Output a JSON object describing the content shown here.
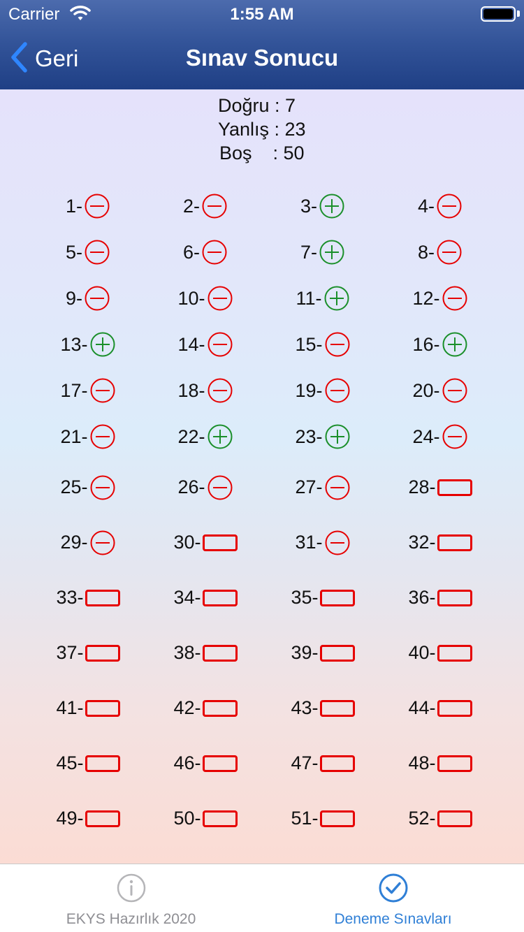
{
  "status_bar": {
    "carrier": "Carrier",
    "time": "1:55 AM",
    "icons": [
      "wifi-icon",
      "battery-icon"
    ]
  },
  "nav": {
    "back_label": "Geri",
    "title": "Sınav Sonucu"
  },
  "summary": {
    "dogru": "Doğru  :  7",
    "yanlis": "Yanlış : 23",
    "bos": "Boş    : 50"
  },
  "colors": {
    "correct": "#1a8f2a",
    "wrong": "#e60000",
    "blank": "#e60000",
    "tab_active": "#2f7fd6",
    "tab_inactive": "#8e8e93"
  },
  "questions": [
    {
      "label": "1-",
      "status": "wrong"
    },
    {
      "label": "2-",
      "status": "wrong"
    },
    {
      "label": "3-",
      "status": "correct"
    },
    {
      "label": "4-",
      "status": "wrong"
    },
    {
      "label": "5-",
      "status": "wrong"
    },
    {
      "label": "6-",
      "status": "wrong"
    },
    {
      "label": "7-",
      "status": "correct"
    },
    {
      "label": "8-",
      "status": "wrong"
    },
    {
      "label": "9-",
      "status": "wrong"
    },
    {
      "label": "10-",
      "status": "wrong"
    },
    {
      "label": "11-",
      "status": "correct"
    },
    {
      "label": "12-",
      "status": "wrong"
    },
    {
      "label": "13-",
      "status": "correct"
    },
    {
      "label": "14-",
      "status": "wrong"
    },
    {
      "label": "15-",
      "status": "wrong"
    },
    {
      "label": "16-",
      "status": "correct"
    },
    {
      "label": "17-",
      "status": "wrong"
    },
    {
      "label": "18-",
      "status": "wrong"
    },
    {
      "label": "19-",
      "status": "wrong"
    },
    {
      "label": "20-",
      "status": "wrong"
    },
    {
      "label": "21-",
      "status": "wrong"
    },
    {
      "label": "22-",
      "status": "correct"
    },
    {
      "label": "23-",
      "status": "correct"
    },
    {
      "label": "24-",
      "status": "wrong"
    },
    {
      "label": "25-",
      "status": "wrong"
    },
    {
      "label": "26-",
      "status": "wrong"
    },
    {
      "label": "27-",
      "status": "wrong"
    },
    {
      "label": "28-",
      "status": "blank"
    },
    {
      "label": "29-",
      "status": "wrong"
    },
    {
      "label": "30-",
      "status": "blank"
    },
    {
      "label": "31-",
      "status": "wrong"
    },
    {
      "label": "32-",
      "status": "blank"
    },
    {
      "label": "33-",
      "status": "blank"
    },
    {
      "label": "34-",
      "status": "blank"
    },
    {
      "label": "35-",
      "status": "blank"
    },
    {
      "label": "36-",
      "status": "blank"
    },
    {
      "label": "37-",
      "status": "blank"
    },
    {
      "label": "38-",
      "status": "blank"
    },
    {
      "label": "39-",
      "status": "blank"
    },
    {
      "label": "40-",
      "status": "blank"
    },
    {
      "label": "41-",
      "status": "blank"
    },
    {
      "label": "42-",
      "status": "blank"
    },
    {
      "label": "43-",
      "status": "blank"
    },
    {
      "label": "44-",
      "status": "blank"
    },
    {
      "label": "45-",
      "status": "blank"
    },
    {
      "label": "46-",
      "status": "blank"
    },
    {
      "label": "47-",
      "status": "blank"
    },
    {
      "label": "48-",
      "status": "blank"
    },
    {
      "label": "49-",
      "status": "blank"
    },
    {
      "label": "50-",
      "status": "blank"
    },
    {
      "label": "51-",
      "status": "blank"
    },
    {
      "label": "52-",
      "status": "blank"
    }
  ],
  "tabbar": {
    "tabs": [
      {
        "label": "EKYS Hazırlık 2020",
        "icon": "info-icon",
        "active": false
      },
      {
        "label": "Deneme Sınavları",
        "icon": "checkmark-circle-icon",
        "active": true
      }
    ]
  }
}
